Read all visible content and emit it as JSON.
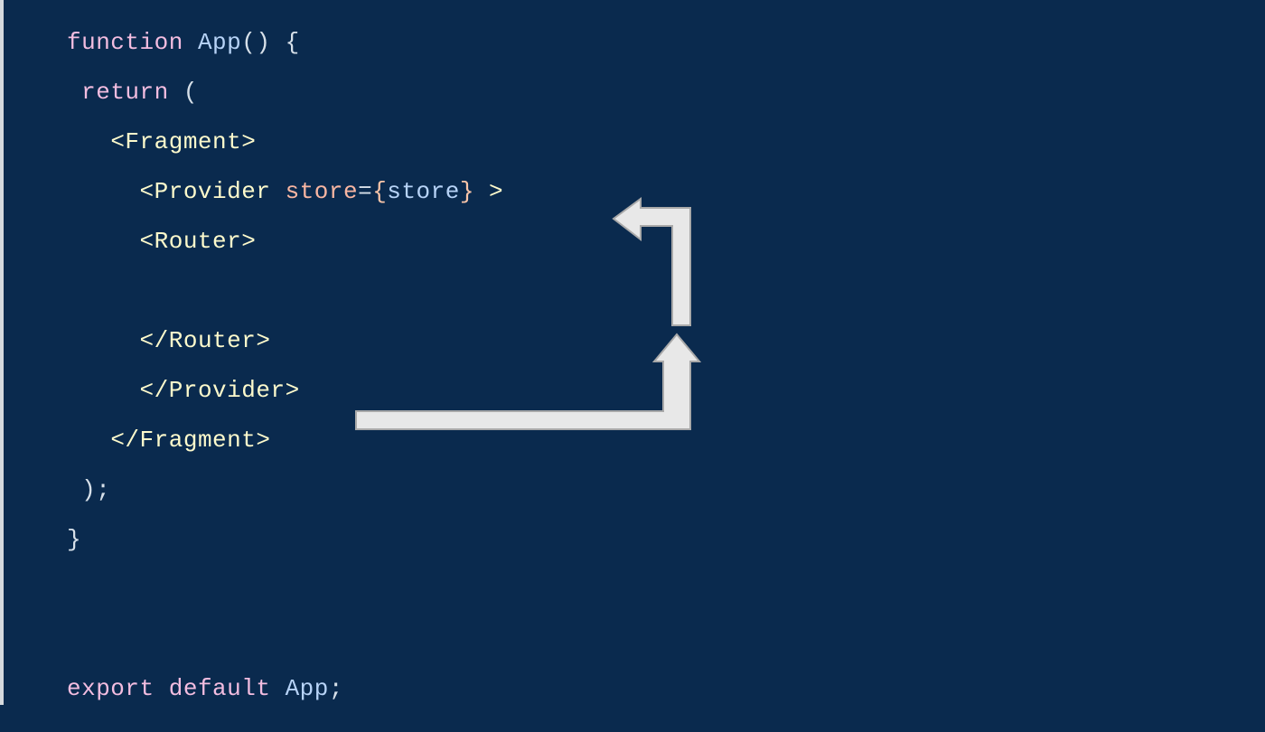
{
  "code": {
    "kw_function": "function",
    "id_app": "App",
    "parens": "()",
    "brace_open": "{",
    "kw_return": "return",
    "paren_open": "(",
    "tag_fragment_open_lt": "<",
    "tag_fragment": "Fragment",
    "tag_gt": ">",
    "tag_provider": "Provider",
    "attr_store": "store",
    "eq": "=",
    "expr_open": "{",
    "id_store": "store",
    "expr_close": "}",
    "tag_router": "Router",
    "tag_close_lt": "</",
    "paren_close": ")",
    "semi": ";",
    "brace_close": "}",
    "kw_export": "export",
    "kw_default": "default"
  }
}
